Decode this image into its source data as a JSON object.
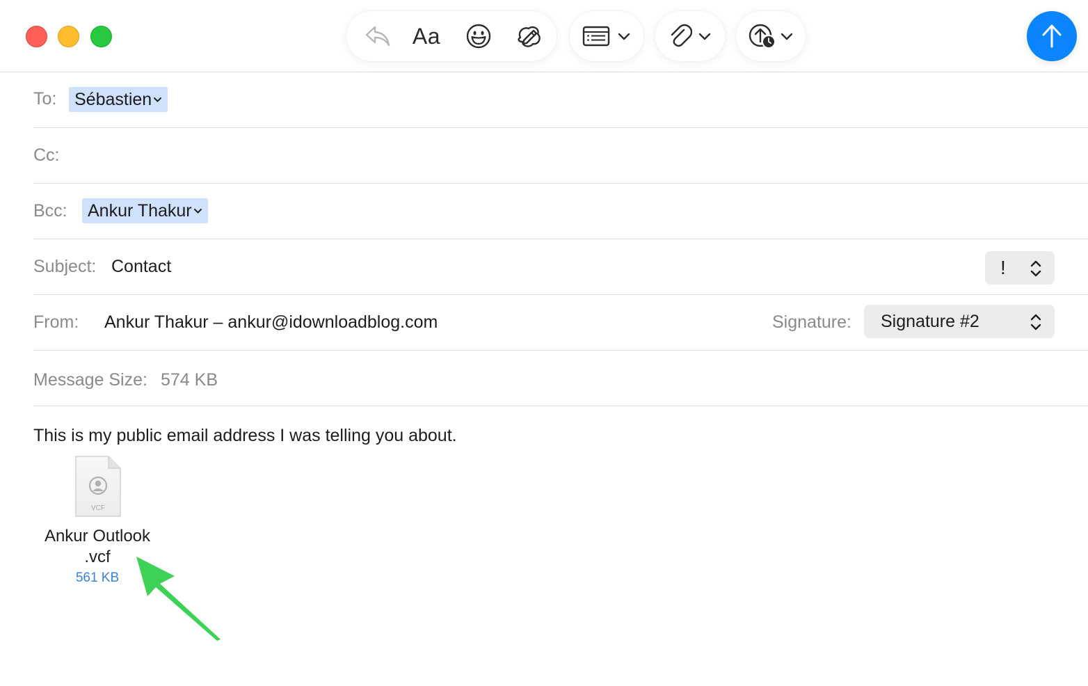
{
  "toolbar": {
    "format_label": "Aa",
    "icons": [
      "reply-icon",
      "emoji-icon",
      "markup-icon",
      "header-fields-icon",
      "attach-icon",
      "send-later-icon",
      "send-icon"
    ]
  },
  "compose": {
    "to": {
      "label": "To:",
      "recipient": "Sébastien"
    },
    "cc": {
      "label": "Cc:"
    },
    "bcc": {
      "label": "Bcc:",
      "recipient": "Ankur Thakur"
    },
    "subject": {
      "label": "Subject:",
      "value": "Contact",
      "priority": "!"
    },
    "from": {
      "label": "From:",
      "value": "Ankur Thakur – ankur@idownloadblog.com"
    },
    "signature": {
      "label": "Signature:",
      "value": "Signature #2"
    },
    "message_size": {
      "label": "Message Size:",
      "value": "574 KB"
    }
  },
  "body": {
    "text": "This is my public email address I was telling you about.",
    "attachment": {
      "name_line1": "Ankur Outlook",
      "name_line2": ".vcf",
      "type_label": "VCF",
      "size": "561 KB"
    }
  },
  "colors": {
    "send_button": "#0a84ff",
    "token_bg": "#cfe1fb",
    "annotation_arrow": "#3dd156",
    "attachment_size": "#3b82d6"
  }
}
